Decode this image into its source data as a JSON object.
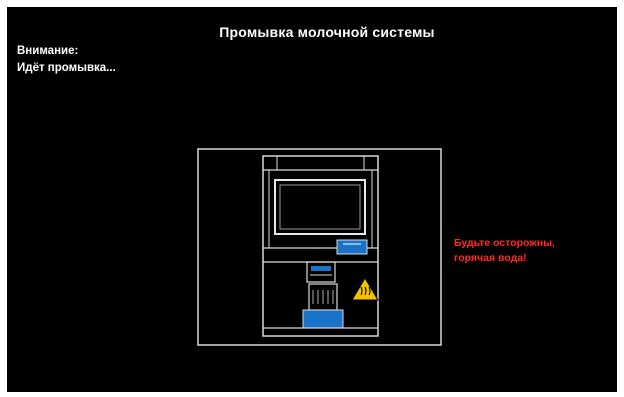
{
  "screen": {
    "title": "Промывка молочной системы",
    "attention_label": "Внимание:",
    "status_text": "Идёт промывка...",
    "caution_line1": "Будьте осторожны,",
    "caution_line2": "горячая вода!"
  },
  "colors": {
    "background": "#000000",
    "text": "#ffffff",
    "caution": "#ff2a2a",
    "accent_blue": "#1a73c9",
    "warning_yellow": "#f2c200"
  },
  "illustration": {
    "icon": "coffee-machine-icon",
    "warning_icon": "hot-water-warning-icon"
  }
}
